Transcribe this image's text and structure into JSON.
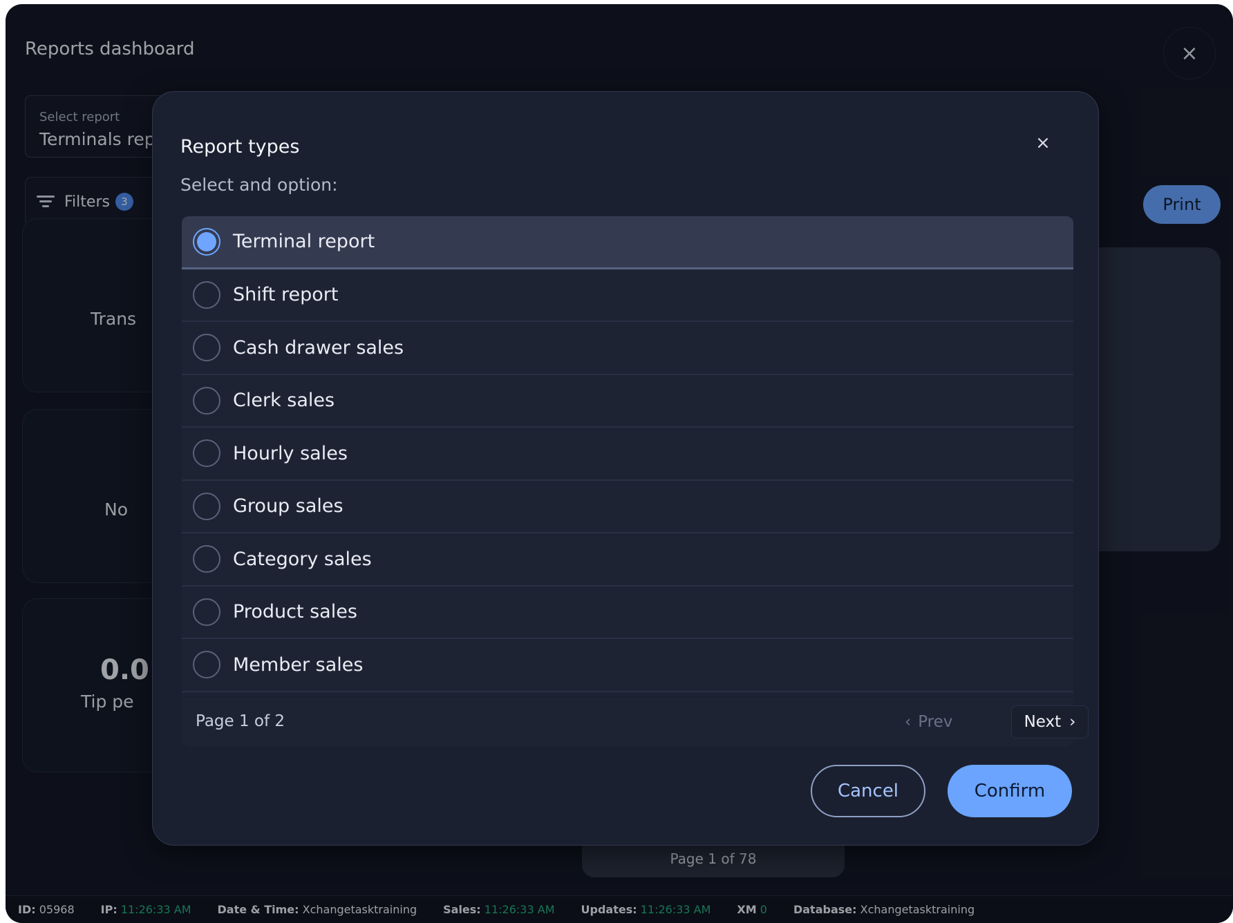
{
  "window": {
    "title": "Reports dashboard",
    "close_icon": "×"
  },
  "report_select": {
    "label": "Select report",
    "value": "Terminals rep"
  },
  "filters": {
    "label": "Filters",
    "count": "3"
  },
  "print_label": "Print",
  "cards": {
    "transactions_label": "Trans",
    "no_label": "No",
    "tip_value": "0.0",
    "tip_label": "Tip pe"
  },
  "background_pager": "Page 1 of 78",
  "status_bar": {
    "id_label": "ID:",
    "id_value": "05968",
    "ip_label": "IP:",
    "ip_value": "11:26:33 AM",
    "datetime_label": "Date & Time:",
    "datetime_value": "Xchangetasktraining",
    "sales_label": "Sales:",
    "sales_value": "11:26:33 AM",
    "updates_label": "Updates:",
    "updates_value": "11:26:33 AM",
    "xm_label": "XM",
    "xm_value": "0",
    "database_label": "Database:",
    "database_value": "Xchangetasktraining"
  },
  "modal": {
    "title": "Report types",
    "subtitle": "Select and option:",
    "close_icon": "×",
    "options": [
      {
        "label": "Terminal report",
        "selected": true
      },
      {
        "label": "Shift report",
        "selected": false
      },
      {
        "label": "Cash drawer sales",
        "selected": false
      },
      {
        "label": "Clerk sales",
        "selected": false
      },
      {
        "label": "Hourly sales",
        "selected": false
      },
      {
        "label": "Group sales",
        "selected": false
      },
      {
        "label": "Category sales",
        "selected": false
      },
      {
        "label": "Product sales",
        "selected": false
      },
      {
        "label": "Member sales",
        "selected": false
      }
    ],
    "pager": {
      "text": "Page 1 of 2",
      "prev_label": "Prev",
      "next_label": "Next"
    },
    "cancel_label": "Cancel",
    "confirm_label": "Confirm"
  },
  "colors": {
    "accent": "#6aa4ff",
    "status_green": "#22b07d",
    "badge": "#4f8cf0"
  }
}
